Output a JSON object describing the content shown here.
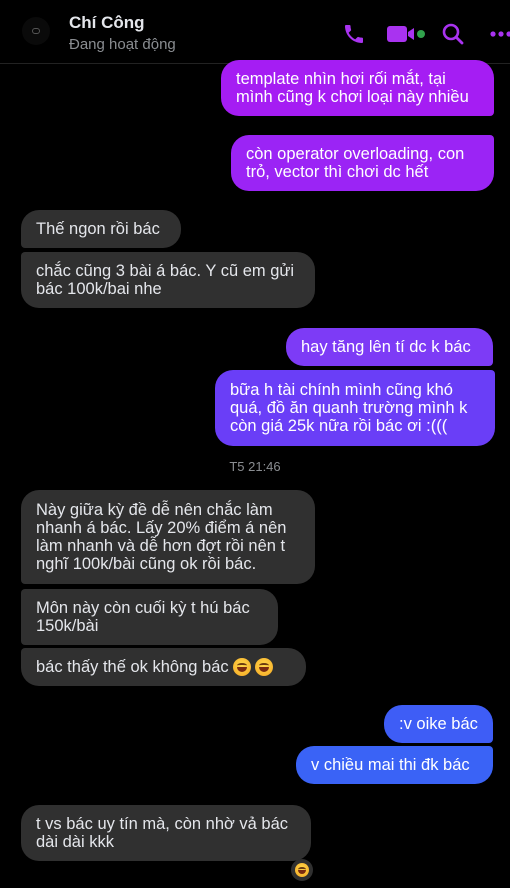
{
  "header": {
    "contact_name": "Chí Công",
    "status": "Đang hoạt động",
    "accent_color": "#a933f0",
    "online_color": "#31a24c",
    "icons": [
      "phone-icon",
      "video-call-icon",
      "search-icon",
      "more-options-icon"
    ]
  },
  "messages": [
    {
      "dir": "out",
      "text": "template nhìn hơi rối mắt, tại\nmình cũng k chơi loại này nhiều"
    },
    {
      "dir": "out",
      "text": "còn operator overloading, con\ntrỏ, vector thì chơi dc hết"
    },
    {
      "dir": "in",
      "text": "Thế ngon rồi bác"
    },
    {
      "dir": "in",
      "text": "chắc cũng 3 bài á bác. Y cũ em gửi\nbác 100k/bai nhe"
    },
    {
      "dir": "out",
      "text": "hay tăng lên tí dc k bác"
    },
    {
      "dir": "out",
      "text": "bữa h tài chính mình cũng khó\nquá, đồ ăn quanh trường mình k\ncòn giá 25k nữa rồi bác ơi :((("
    },
    {
      "dir": "in",
      "text": "Này giữa kỳ đề dễ nên chắc làm\nnhanh á bác. Lấy 20% điểm á nên\nlàm nhanh và dễ hơn đợt rồi nên t\nnghĩ 100k/bài cũng ok rồi bác."
    },
    {
      "dir": "in",
      "text": "Môn này còn cuối kỳ t hú bác\n150k/bài"
    },
    {
      "dir": "in",
      "text": "bác thấy thế ok không bác"
    },
    {
      "dir": "out",
      "text": ":v oike bác"
    },
    {
      "dir": "out",
      "text": "v chiều mai thi đk bác"
    },
    {
      "dir": "in",
      "text": "t vs bác uy tín mà, còn nhờ vả bác\ndài dài kkk"
    }
  ],
  "timestamp": "T5 21:46",
  "reaction": "grinning-squint-emoji"
}
